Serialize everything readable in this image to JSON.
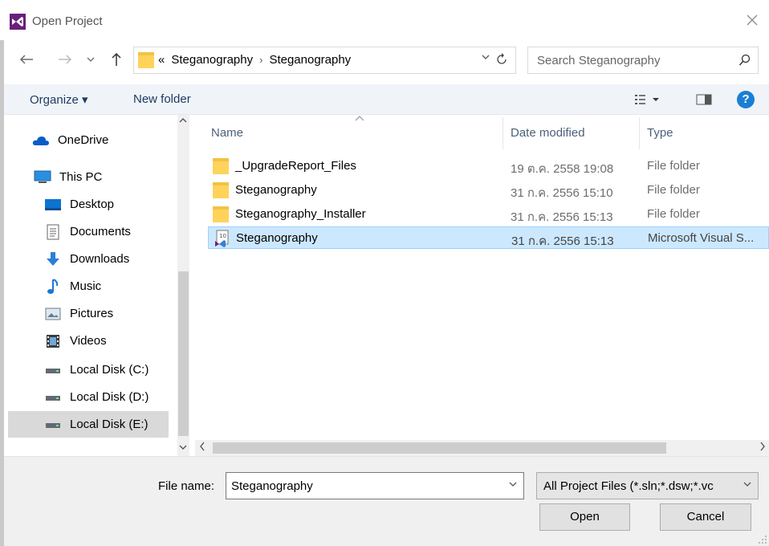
{
  "window": {
    "title": "Open Project",
    "icon": "visual-studio-logo",
    "accent": "#68217a"
  },
  "address": {
    "overflow_glyph": "«",
    "crumbs": [
      "Steganography",
      "Steganography"
    ],
    "search_placeholder": "Search Steganography"
  },
  "toolbar": {
    "organize_label": "Organize ▾",
    "new_folder_label": "New folder",
    "help_label": "?"
  },
  "sidebar": {
    "items": [
      {
        "label": "OneDrive",
        "icon": "onedrive-icon"
      },
      {
        "label": "This PC",
        "icon": "pc-icon"
      },
      {
        "label": "Desktop",
        "icon": "desktop-icon"
      },
      {
        "label": "Documents",
        "icon": "documents-icon"
      },
      {
        "label": "Downloads",
        "icon": "downloads-icon"
      },
      {
        "label": "Music",
        "icon": "music-icon"
      },
      {
        "label": "Pictures",
        "icon": "pictures-icon"
      },
      {
        "label": "Videos",
        "icon": "videos-icon"
      },
      {
        "label": "Local Disk (C:)",
        "icon": "drive-icon"
      },
      {
        "label": "Local Disk (D:)",
        "icon": "drive-icon"
      },
      {
        "label": "Local Disk (E:)",
        "icon": "drive-icon",
        "selected": true
      }
    ]
  },
  "filelist": {
    "columns": {
      "name": "Name",
      "date": "Date modified",
      "type": "Type"
    },
    "rows": [
      {
        "name": "_UpgradeReport_Files",
        "date": "19 ต.ค. 2558 19:08",
        "type": "File folder",
        "icon": "folder-icon"
      },
      {
        "name": "Steganography",
        "date": "31 ก.ค. 2556 15:10",
        "type": "File folder",
        "icon": "folder-icon"
      },
      {
        "name": "Steganography_Installer",
        "date": "31 ก.ค. 2556 15:13",
        "type": "File folder",
        "icon": "folder-icon"
      },
      {
        "name": "Steganography",
        "date": "31 ก.ค. 2556 15:13",
        "type": "Microsoft Visual S...",
        "icon": "vs-solution-icon",
        "selected": true
      }
    ]
  },
  "bottom": {
    "filename_label": "File name:",
    "filename_value": "Steganography",
    "filetype_value": "All Project Files (*.sln;*.dsw;*.vc",
    "open_label": "Open",
    "cancel_label": "Cancel"
  },
  "colors": {
    "selection_bg": "#cce8ff",
    "selection_border": "#99d1ff",
    "toolbar_bg": "#f0f4f9",
    "folder_yellow": "#ffd35a",
    "help_blue": "#1a7fd4"
  }
}
